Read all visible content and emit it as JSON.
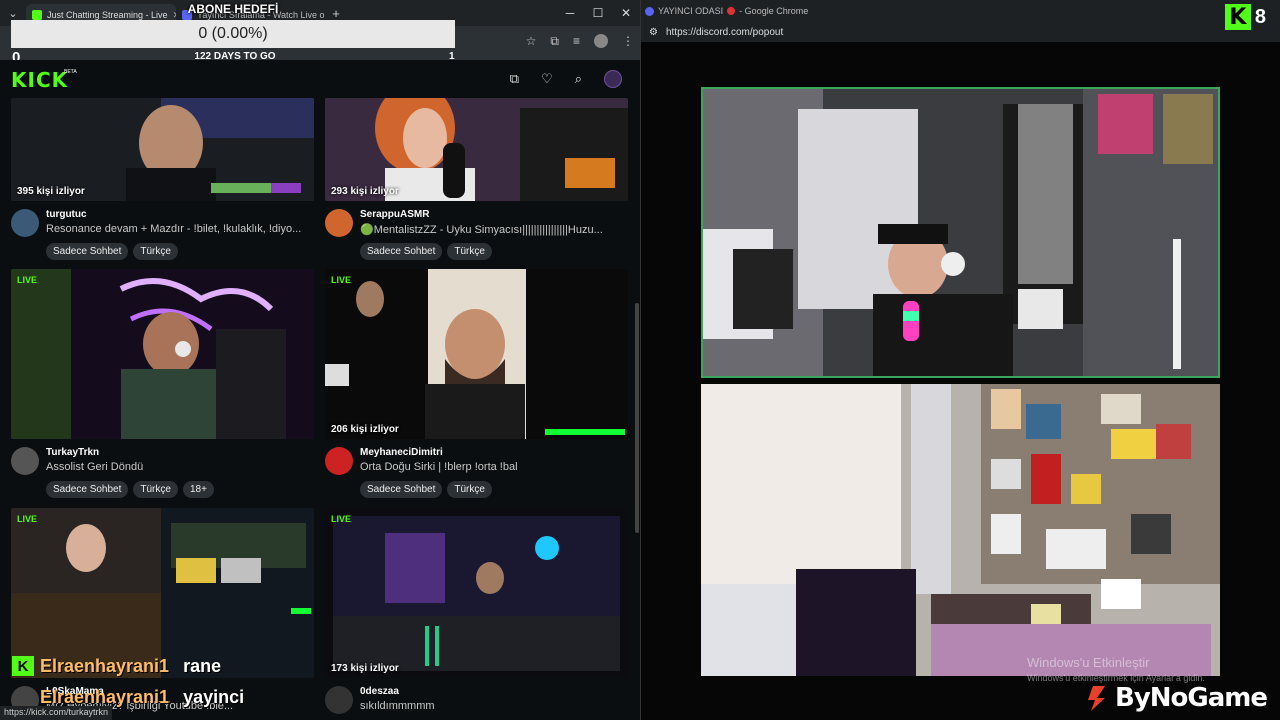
{
  "left_browser": {
    "tabs": [
      {
        "label": "Just Chatting Streaming - Live",
        "active": true
      },
      {
        "label": "Yayıncı Sıralama - Watch Live o",
        "active": false
      }
    ],
    "goal_overlay": {
      "title": "ABONE HEDEFİ",
      "progress_text": "0 (0.00%)",
      "days_left": "122 DAYS TO GO",
      "min": "0",
      "max": "1",
      "progress_fraction": 0
    },
    "status_url": "https://kick.com/turkaytrkn"
  },
  "kick": {
    "logo": "KICK",
    "beta": "BETA",
    "accent": "#53fc18"
  },
  "streams": [
    {
      "channel": "turgutuc",
      "title": "Resonance devam + Mazdır - !bilet, !kulaklık, !diyo...",
      "viewers": "395 kişi izliyor",
      "live": "",
      "tags": [
        "Sadece Sohbet",
        "Türkçe"
      ]
    },
    {
      "channel": "SerappuASMR",
      "title": "🟢MentalistzZZ - Uyku Simyacısı||||||||||||||||Huzu...",
      "viewers": "293 kişi izliyor",
      "live": "",
      "tags": [
        "Sadece Sohbet",
        "Türkçe"
      ]
    },
    {
      "channel": "TurkayTrkn",
      "title": "Assolist Geri Döndü",
      "viewers": "",
      "live": "LIVE",
      "tags": [
        "Sadece Sohbet",
        "Türkçe",
        "18+"
      ]
    },
    {
      "channel": "MeyhaneciDimitri",
      "title": "Orta Doğu Sirki | !blerp !orta !bal",
      "viewers": "206 kişi izliyor",
      "live": "LIVE",
      "tags": [
        "Sadece Sohbet",
        "Türkçe"
      ]
    },
    {
      "channel": "L0SkaMama",
      "title": "Mtz Hypemiyiz? işbirliği Youtube !ble...",
      "viewers": "",
      "live": "LIVE",
      "tags": []
    },
    {
      "channel": "0deszaa",
      "title": "sıkıldımmmmm",
      "viewers": "173 kişi izliyor",
      "live": "LIVE",
      "tags": []
    }
  ],
  "alerts": [
    {
      "name": "Elraenhayrani1",
      "suffix": "rane"
    },
    {
      "name": "Elraenhayrani1",
      "suffix": "yayinci"
    }
  ],
  "right_browser": {
    "title": "YAYINCI ODASI",
    "app": "- Google Chrome",
    "url": "https://discord.com/popout",
    "counter_icon": "K",
    "counter": "8",
    "cam_border_color": "#3ba55c"
  },
  "watermark": {
    "line1": "Windows'u Etkinleştir",
    "line2": "Windows'u etkinleştirmek için Ayarlar'a gidin."
  },
  "brand": "ByNoGame"
}
